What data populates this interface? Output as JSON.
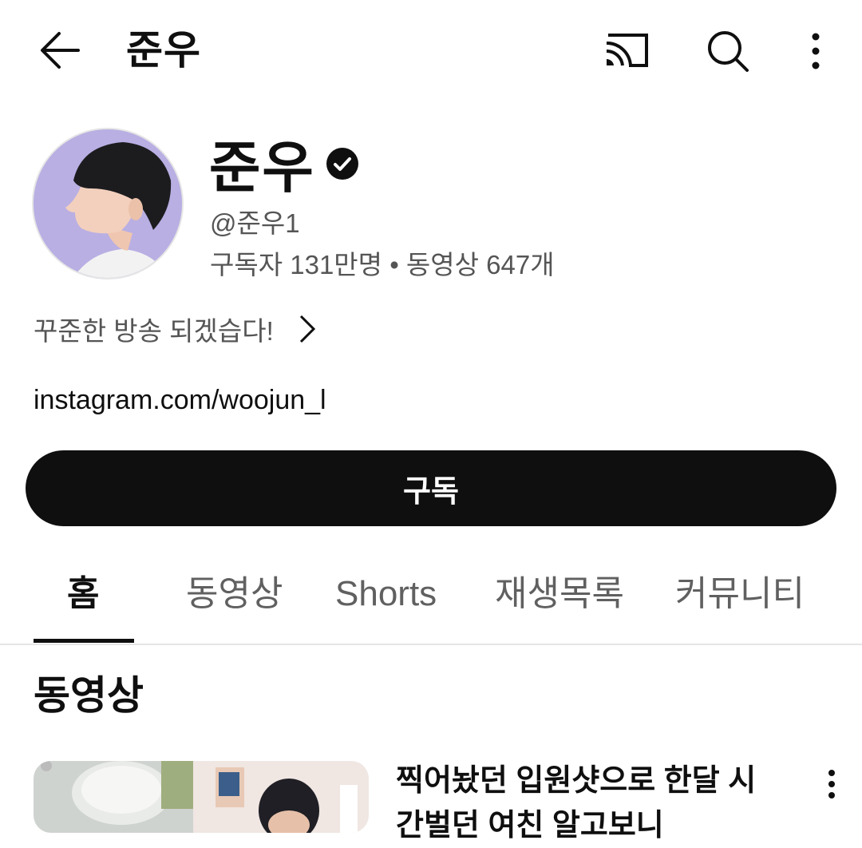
{
  "header": {
    "title": "준우",
    "back_icon": "arrow-left-icon",
    "cast_icon": "cast-icon",
    "search_icon": "search-icon",
    "more_icon": "more-vertical-icon"
  },
  "channel": {
    "name": "준우",
    "verified": true,
    "handle": "@준우1",
    "stats": "구독자 131만명 • 동영상 647개",
    "description": "꾸준한 방송 되겠습다!",
    "link": "instagram.com/woojun_l",
    "subscribe_label": "구독"
  },
  "tabs": [
    {
      "label": "홈",
      "active": true
    },
    {
      "label": "동영상",
      "active": false
    },
    {
      "label": "Shorts",
      "active": false
    },
    {
      "label": "재생목록",
      "active": false
    },
    {
      "label": "커뮤니티",
      "active": false
    }
  ],
  "section": {
    "title": "동영상"
  },
  "video": {
    "title": "찍어놨던 입원샷으로 한달 시간벌던 여친 알고보니"
  },
  "colors": {
    "text_primary": "#0f0f0f",
    "text_secondary": "#606060",
    "avatar_bg": "#b9afe3",
    "subscribe_bg": "#0f0f0f"
  }
}
